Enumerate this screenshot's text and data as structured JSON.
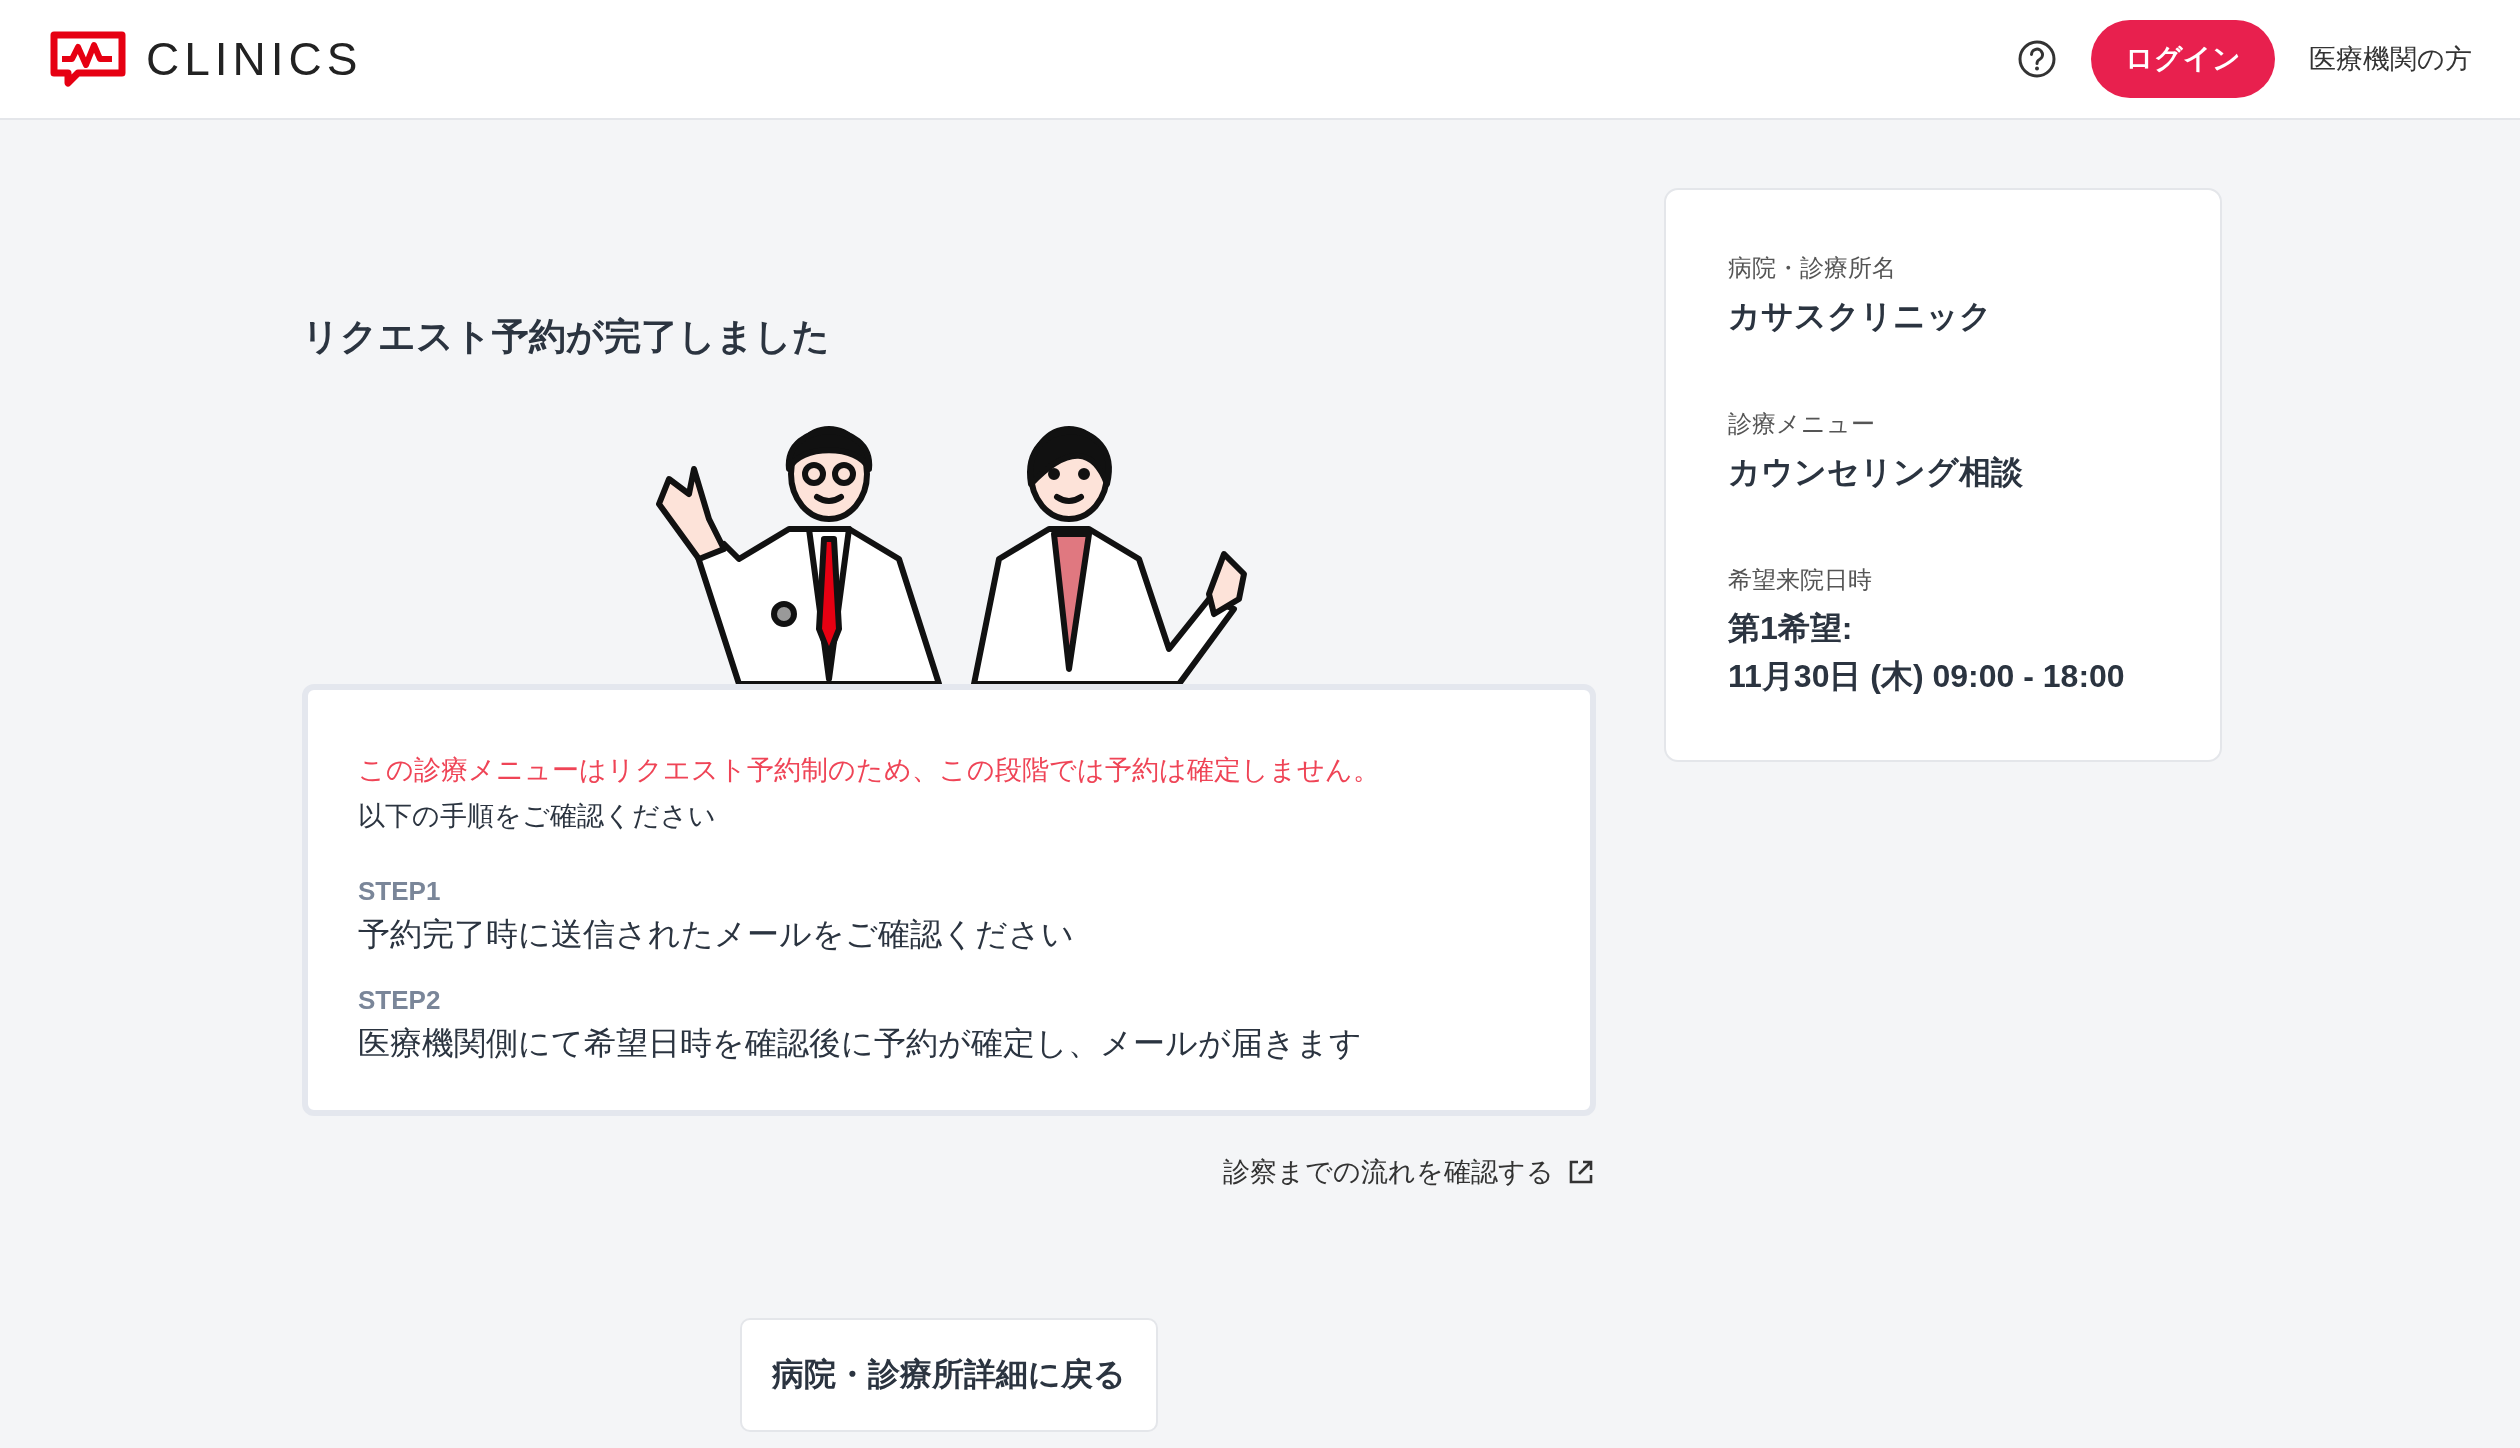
{
  "header": {
    "logo_text": "CLINICS",
    "login_button": "ログイン",
    "institution_link": "医療機関の方"
  },
  "title": "リクエスト予約が完了しました",
  "notice": {
    "warning": "この診療メニューはリクエスト予約制のため、この段階では予約は確定しません。",
    "intro": "以下の手順をご確認ください",
    "steps": [
      {
        "label": "STEP1",
        "text": "予約完了時に送信されたメールをご確認ください"
      },
      {
        "label": "STEP2",
        "text": "医療機関側にて希望日時を確認後に予約が確定し、メールが届きます"
      }
    ]
  },
  "flow_link": "診察までの流れを確認する",
  "back_button": "病院・診療所詳細に戻る",
  "summary": [
    {
      "label": "病院・診療所名",
      "lines": [
        "カサスクリニック"
      ]
    },
    {
      "label": "診療メニュー",
      "lines": [
        "カウンセリング相談"
      ]
    },
    {
      "label": "希望来院日時",
      "lines": [
        "第1希望:",
        "11月30日 (木) 09:00 - 18:00"
      ]
    }
  ]
}
